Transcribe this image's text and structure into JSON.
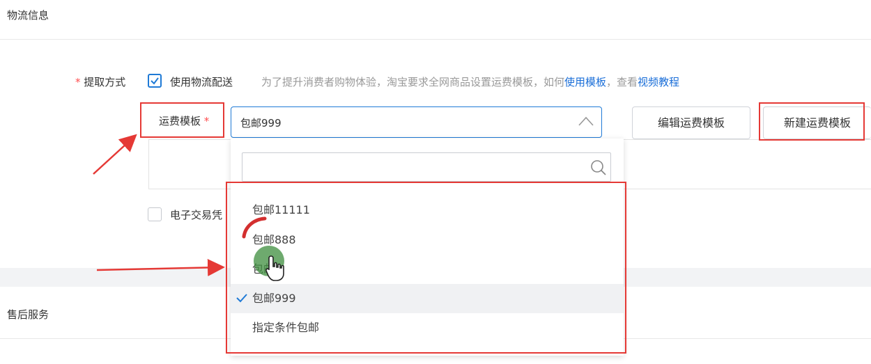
{
  "logistics": {
    "section_title": "物流信息",
    "pickup_label": "提取方式",
    "required_mark": "*",
    "use_logistics_label": "使用物流配送",
    "hint_prefix": "为了提升消费者购物体验，淘宝要求全网商品设置运费模板，如何",
    "hint_link1": "使用模板",
    "hint_mid": "，查看",
    "hint_link2": "视频教程",
    "template_label": "运费模板",
    "template_value": "包邮999",
    "edit_button": "编辑运费模板",
    "new_button": "新建运费模板",
    "e_voucher_label": "电子交易凭"
  },
  "dropdown": {
    "search_value": "",
    "options": [
      "包邮11111",
      "包邮888",
      "包邮",
      "包邮999",
      "指定条件包邮"
    ],
    "selected_index": 3
  },
  "after_sales": {
    "section_title": "售后服务"
  },
  "colors": {
    "accent": "#1f7ad6",
    "annotation_red": "#e53935",
    "link": "#1a6ed8"
  }
}
